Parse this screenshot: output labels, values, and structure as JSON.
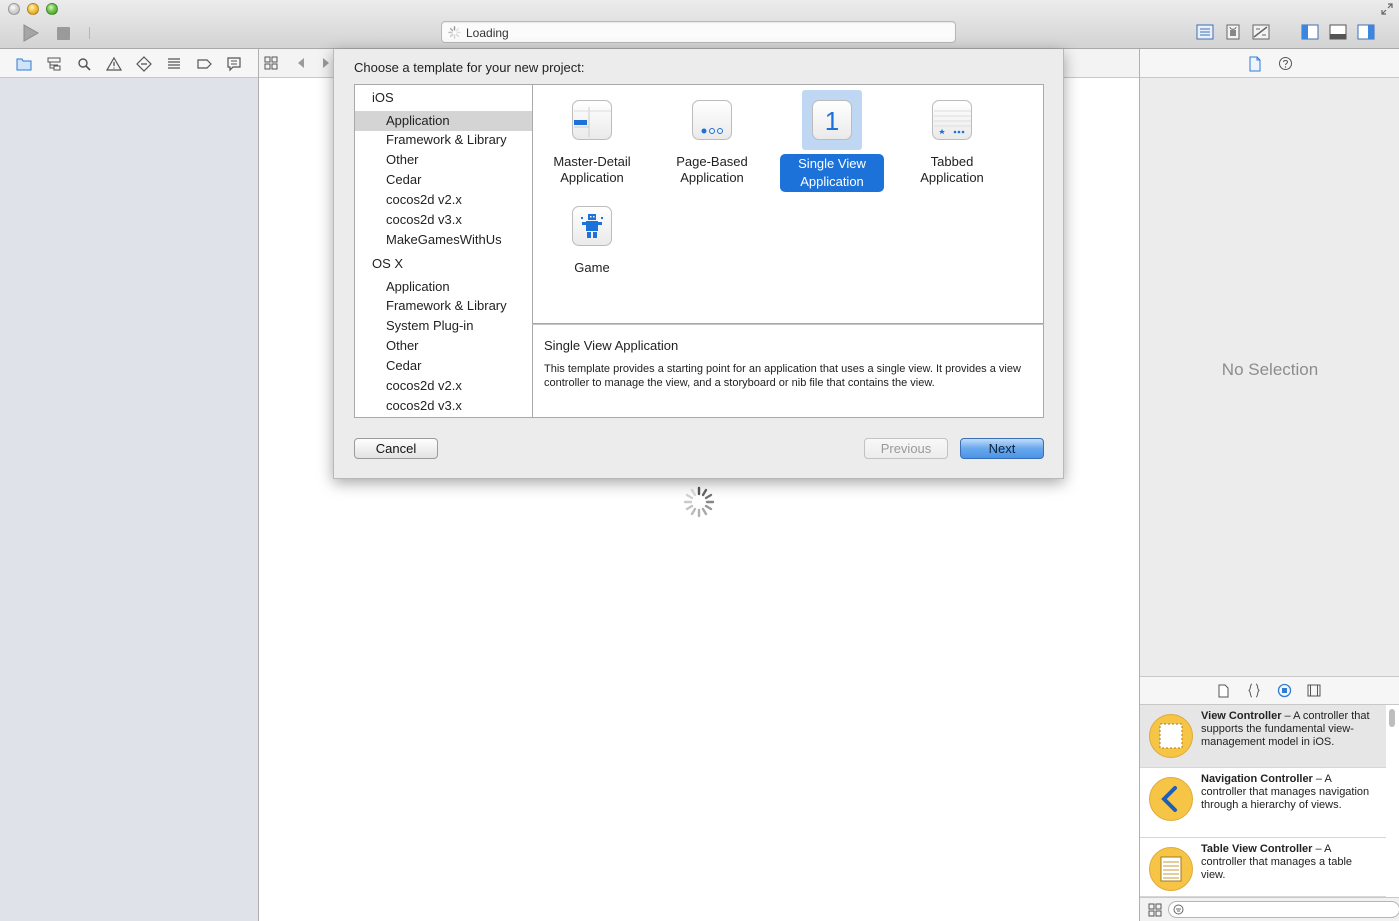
{
  "toolbar": {
    "activity_status": "Loading"
  },
  "sheet": {
    "title": "Choose a template for your new project:",
    "categories": [
      {
        "heading": "iOS",
        "items": [
          "Application",
          "Framework & Library",
          "Other",
          "Cedar",
          "cocos2d v2.x",
          "cocos2d v3.x",
          "MakeGamesWithUs"
        ]
      },
      {
        "heading": "OS X",
        "items": [
          "Application",
          "Framework & Library",
          "System Plug-in",
          "Other",
          "Cedar",
          "cocos2d v2.x",
          "cocos2d v3.x"
        ]
      }
    ],
    "selected_category": "Application",
    "templates": [
      {
        "line1": "Master-Detail",
        "line2": "Application",
        "icon": "master-detail-icon"
      },
      {
        "line1": "Page-Based",
        "line2": "Application",
        "icon": "page-based-icon"
      },
      {
        "line1": "Single View",
        "line2": "Application",
        "icon": "single-view-icon",
        "icon_text": "1"
      },
      {
        "line1": "Tabbed",
        "line2": "Application",
        "icon": "tabbed-icon"
      },
      {
        "line1": "Game",
        "line2": "",
        "icon": "game-icon"
      }
    ],
    "selected_template": "Single View Application",
    "description": {
      "title": "Single View Application",
      "text": "This template provides a starting point for an application that uses a single view. It provides a view controller to manage the view, and a storyboard or nib file that contains the view."
    },
    "buttons": {
      "cancel": "Cancel",
      "previous": "Previous",
      "next": "Next"
    }
  },
  "inspector": {
    "empty_label": "No Selection"
  },
  "library": {
    "items": [
      {
        "name": "View Controller",
        "desc": " – A controller that supports the fundamental view-management model in iOS.",
        "icon": "view-controller-icon"
      },
      {
        "name": "Navigation Controller",
        "desc": " – A controller that manages navigation through a hierarchy of views.",
        "icon": "navigation-controller-icon"
      },
      {
        "name": "Table View Controller",
        "desc": " – A controller that manages a table view.",
        "icon": "table-view-controller-icon"
      }
    ]
  },
  "colors": {
    "accent": "#1c72d8",
    "selection_highlight": "#bfd7f3",
    "sidebar_bg": "#dfe3e9",
    "library_badge": "#f7c545"
  }
}
